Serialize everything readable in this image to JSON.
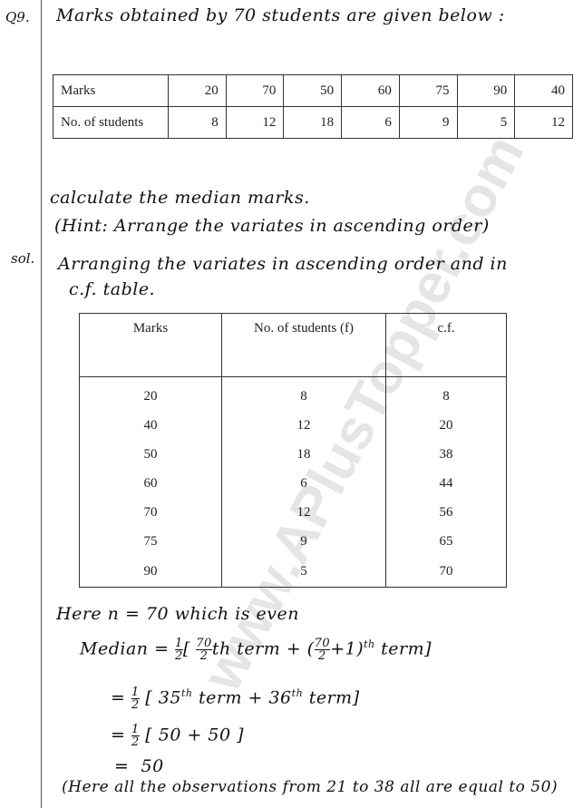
{
  "question": {
    "number": "Q9.",
    "text": "Marks obtained by 70 students are given below :",
    "table": {
      "row_labels": [
        "Marks",
        "No. of students"
      ],
      "marks": [
        "20",
        "70",
        "50",
        "60",
        "75",
        "90",
        "40"
      ],
      "students": [
        "8",
        "12",
        "18",
        "6",
        "9",
        "5",
        "12"
      ]
    },
    "instruction": "calculate the median marks.",
    "hint": "(Hint: Arrange the variates in ascending order)"
  },
  "solution": {
    "label": "sol.",
    "intro_line1": "Arranging the variates in ascending order and in",
    "intro_line2": "c.f. table.",
    "table": {
      "headers": [
        "Marks",
        "No. of students (f)",
        "c.f."
      ],
      "rows": [
        [
          "20",
          "8",
          "8"
        ],
        [
          "40",
          "12",
          "20"
        ],
        [
          "50",
          "18",
          "38"
        ],
        [
          "60",
          "6",
          "44"
        ],
        [
          "70",
          "12",
          "56"
        ],
        [
          "75",
          "9",
          "65"
        ],
        [
          "90",
          "5",
          "70"
        ]
      ]
    },
    "step1": "Here n = 70 which is even",
    "median_label": "Median",
    "eq_sign": "=",
    "half_num": "1",
    "half_den": "2",
    "step2_a": "[",
    "frac70_num": "70",
    "frac70_den": "2",
    "step2_b": "th term + (",
    "step2_c": "+1)",
    "th": "th",
    "step2_d": " term]",
    "step3": "[ 35",
    "step3_b": " term + 36",
    "step3_c": " term]",
    "step4": "[ 50 + 50 ]",
    "step5": "50",
    "note": "(Here all the observations from 21 to 38 all are equal to 50)"
  },
  "watermark": "www.APlusTopper.com"
}
